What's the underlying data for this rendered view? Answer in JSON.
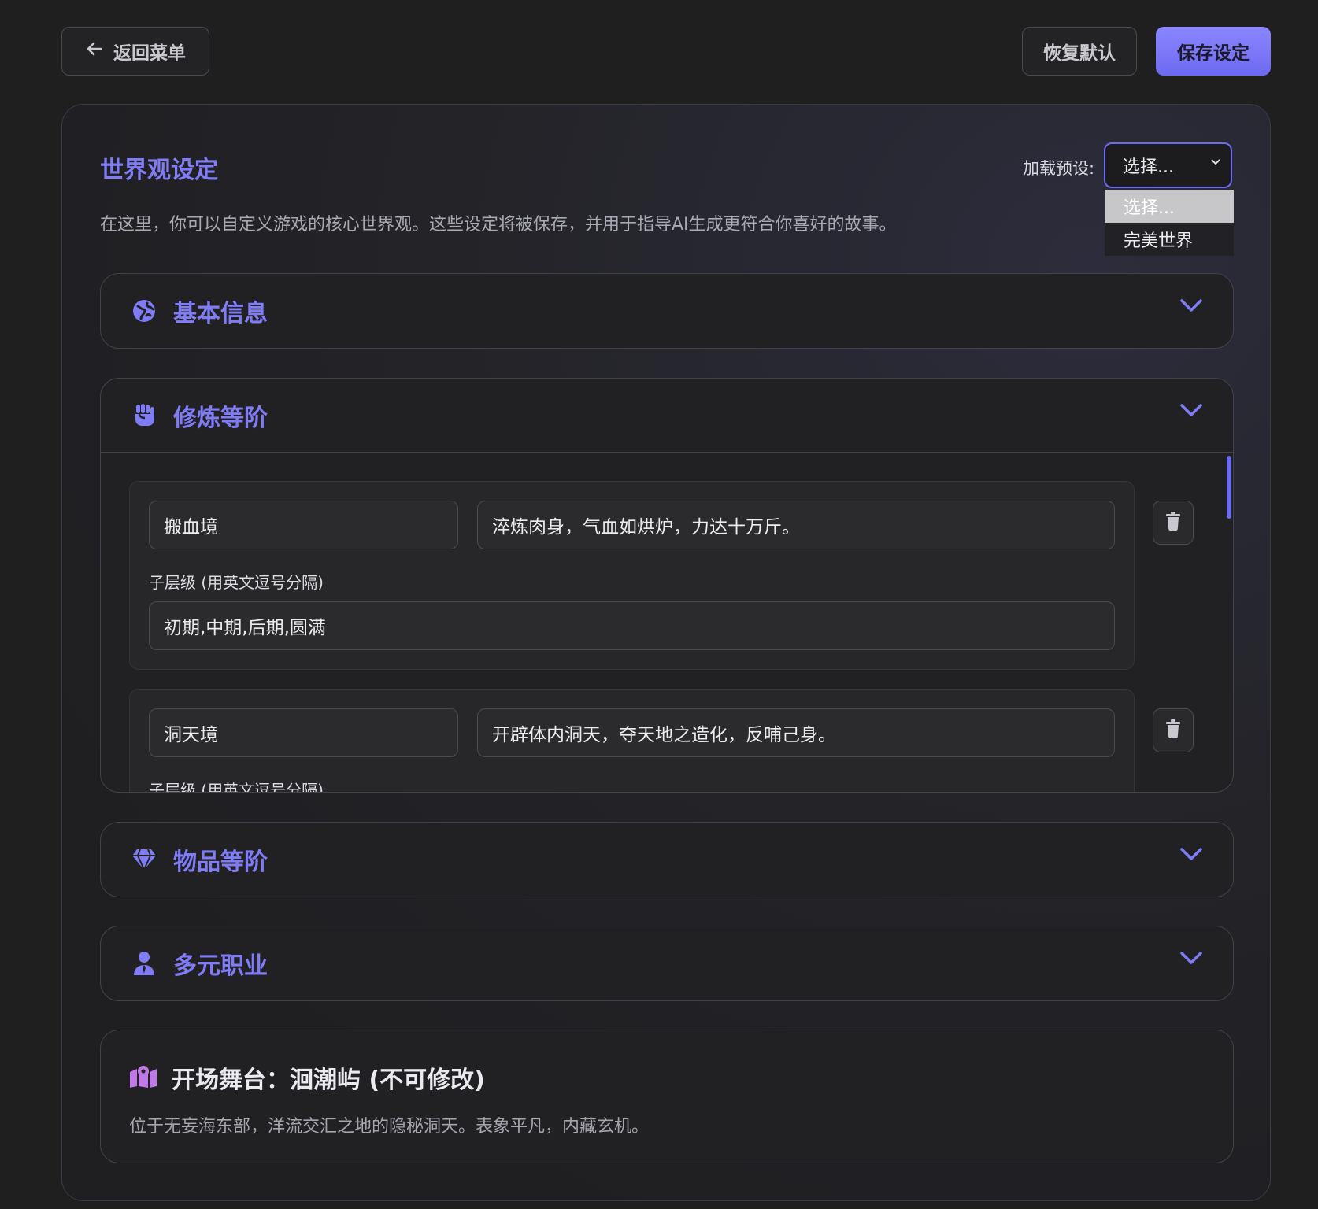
{
  "toolbar": {
    "back_label": "返回菜单",
    "reset_label": "恢复默认",
    "save_label": "保存设定"
  },
  "panel": {
    "title": "世界观设定",
    "description": "在这里，你可以自定义游戏的核心世界观。这些设定将被保存，并用于指导AI生成更符合你喜好的故事。",
    "preset": {
      "label": "加载预设:",
      "selected": "选择...",
      "options": [
        "选择...",
        "完美世界"
      ]
    }
  },
  "sections": {
    "basic": {
      "label": "基本信息",
      "icon": "globe-icon"
    },
    "cultivation": {
      "label": "修炼等阶",
      "icon": "fist-icon",
      "tiers": [
        {
          "name": "搬血境",
          "desc": "淬炼肉身，气血如烘炉，力达十万斤。",
          "sub_label": "子层级 (用英文逗号分隔)",
          "sub": "初期,中期,后期,圆满"
        },
        {
          "name": "洞天境",
          "desc": "开辟体内洞天，夺天地之造化，反哺己身。",
          "sub_label": "子层级 (用英文逗号分隔)",
          "sub": ""
        }
      ]
    },
    "items": {
      "label": "物品等阶",
      "icon": "gem-icon"
    },
    "jobs": {
      "label": "多元职业",
      "icon": "user-tie-icon"
    },
    "stage": {
      "title": "开场舞台：洄潮屿 (不可修改)",
      "desc": "位于无妄海东部，洋流交汇之地的隐秘洞天。表象平凡，内藏玄机。",
      "icon": "map-location-icon"
    }
  },
  "colors": {
    "accent": "#7f7cf6",
    "stage_icon": "#c07ae8",
    "background": "#1f1f20"
  }
}
